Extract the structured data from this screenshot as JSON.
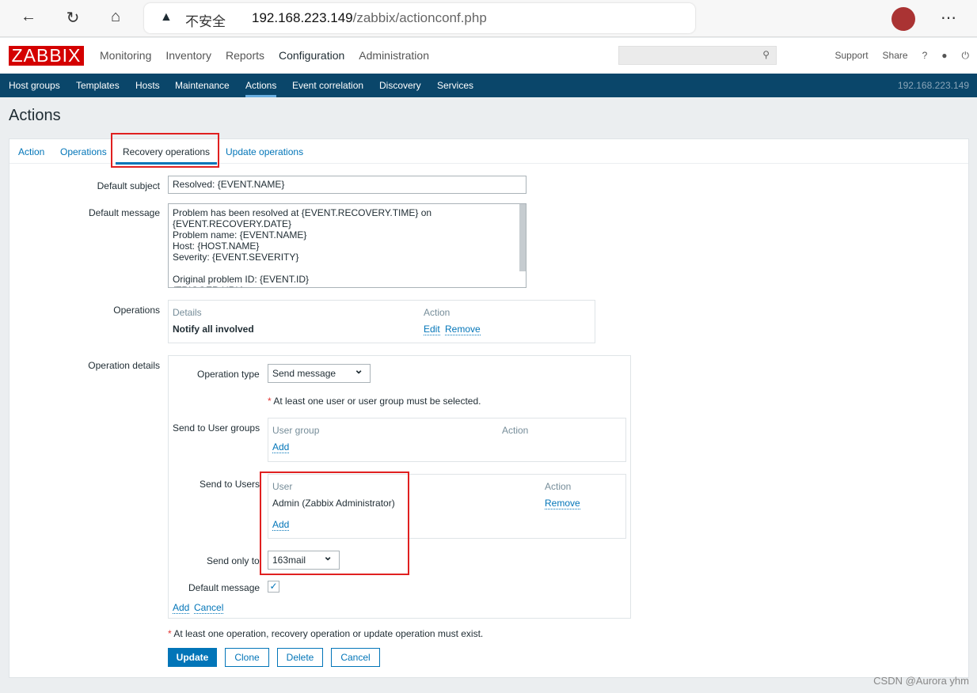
{
  "browser": {
    "insecure": "不安全",
    "url_host": "192.168.223.149",
    "url_path": "/zabbix/actionconf.php"
  },
  "header": {
    "logo": "ZABBIX",
    "nav": [
      "Monitoring",
      "Inventory",
      "Reports",
      "Configuration",
      "Administration"
    ],
    "support": "Support",
    "share": "Share",
    "help": "?"
  },
  "subnav": {
    "items": [
      "Host groups",
      "Templates",
      "Hosts",
      "Maintenance",
      "Actions",
      "Event correlation",
      "Discovery",
      "Services"
    ],
    "server": "192.168.223.149"
  },
  "page": {
    "title": "Actions"
  },
  "tabs": [
    "Action",
    "Operations",
    "Recovery operations",
    "Update operations"
  ],
  "form": {
    "subject_label": "Default subject",
    "subject_value": "Resolved: {EVENT.NAME}",
    "message_label": "Default message",
    "message_value": "Problem has been resolved at {EVENT.RECOVERY.TIME} on\n{EVENT.RECOVERY.DATE}\nProblem name: {EVENT.NAME}\nHost: {HOST.NAME}\nSeverity: {EVENT.SEVERITY}\n\nOriginal problem ID: {EVENT.ID}\n{TRIGGER.URL}",
    "operations_label": "Operations",
    "ops_col_details": "Details",
    "ops_col_action": "Action",
    "op_row": "Notify all involved",
    "edit": "Edit",
    "remove": "Remove",
    "opdetails_label": "Operation details",
    "optype_label": "Operation type",
    "optype_value": "Send message",
    "warning": "At least one user or user group must be selected.",
    "usergroups_label": "Send to User groups",
    "ug_col": "User group",
    "ug_action": "Action",
    "add": "Add",
    "users_label": "Send to Users",
    "u_col": "User",
    "u_action": "Action",
    "user_row": "Admin (Zabbix Administrator)",
    "sendonly_label": "Send only to",
    "sendonly_value": "163mail",
    "defmsg_label": "Default message",
    "cancel": "Cancel",
    "footer_warning": "At least one operation, recovery operation or update operation must exist.",
    "buttons": {
      "update": "Update",
      "clone": "Clone",
      "delete": "Delete",
      "cancel": "Cancel"
    }
  },
  "watermark": "CSDN @Aurora yhm"
}
